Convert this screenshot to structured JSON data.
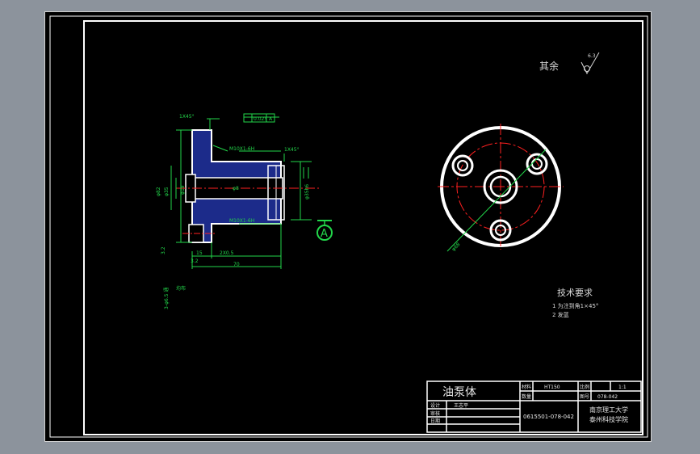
{
  "roughness": {
    "label": "其余",
    "value": "6.3"
  },
  "tech_req": {
    "title": "技术要求",
    "items": [
      "1  为注到角1×45°",
      "2  发蓝"
    ]
  },
  "section": {
    "dims": {
      "chamfer_top": "1X45°",
      "gdt_tol": "0.025",
      "gdt_datum": "A",
      "thread_upper": "M10X1-6H",
      "thread_lower": "M10X1-6H",
      "chamfer_right": "1X45°",
      "dia_outer": "φ82",
      "dia_hub": "φ35",
      "dia_bore": "φ19",
      "dia_right": "φ35h6",
      "dia_mid": "φ8",
      "len_15": "15",
      "len_groove": "2X0.5",
      "len_70": "70",
      "rough_left": "3.2",
      "rough_bottom": "3.2",
      "note_left": "3-φ6.5 通",
      "note_left2": "均布"
    },
    "datum_label": "A"
  },
  "end_view": {
    "dia_label": "φ68"
  },
  "title_block": {
    "part_name": "油泵体",
    "material_label": "材料",
    "material_value": "HT150",
    "scale_label": "比例",
    "scale_value": "1:1",
    "qty_label": "数量",
    "drawing_no_label": "图号",
    "drawing_no_value": "078-042",
    "designer_label": "设计",
    "designer_value": "王志平",
    "checker_label": "审核",
    "date_label": "日期",
    "student_id": "0615501-078-042",
    "school_line1": "南京理工大学",
    "school_line2": "泰州科技学院"
  },
  "colors": {
    "background": "#000000",
    "window": "#8c939c",
    "border": "#ffffff",
    "dimension": "#22d64a",
    "section_fill": "#1c2b8a",
    "center_line": "#ff2020"
  }
}
